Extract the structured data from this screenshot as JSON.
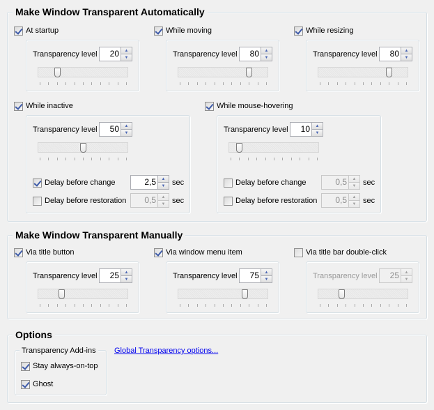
{
  "auto_group": {
    "title": "Make Window Transparent Automatically",
    "at_startup": {
      "label": "At startup",
      "checked": true,
      "level_label": "Transparency level",
      "level": "20",
      "slider_percent": 20
    },
    "while_moving": {
      "label": "While moving",
      "checked": true,
      "level_label": "Transparency level",
      "level": "80",
      "slider_percent": 80
    },
    "while_resizing": {
      "label": "While resizing",
      "checked": true,
      "level_label": "Transparency level",
      "level": "80",
      "slider_percent": 80
    },
    "while_inactive": {
      "label": "While inactive",
      "checked": true,
      "level_label": "Transparency level",
      "level": "50",
      "slider_percent": 50,
      "delay_change": {
        "label": "Delay before change",
        "checked": true,
        "value": "2,5",
        "unit": "sec"
      },
      "delay_restore": {
        "label": "Delay before restoration",
        "checked": false,
        "value": "0,5",
        "unit": "sec"
      }
    },
    "while_hovering": {
      "label": "While mouse-hovering",
      "checked": true,
      "level_label": "Transparency level",
      "level": "10",
      "slider_percent": 10,
      "delay_change": {
        "label": "Delay before change",
        "checked": false,
        "value": "0,5",
        "unit": "sec"
      },
      "delay_restore": {
        "label": "Delay before restoration",
        "checked": false,
        "value": "0,5",
        "unit": "sec"
      }
    }
  },
  "manual_group": {
    "title": "Make Window Transparent Manually",
    "via_title_button": {
      "label": "Via title button",
      "checked": true,
      "level_label": "Transparency level",
      "level": "25",
      "slider_percent": 25
    },
    "via_window_menu": {
      "label": "Via window menu item",
      "checked": true,
      "level_label": "Transparency level",
      "level": "75",
      "slider_percent": 75
    },
    "via_double_click": {
      "label": "Via title bar double-click",
      "checked": false,
      "level_label": "Transparency level",
      "level": "25",
      "slider_percent": 25
    }
  },
  "options_group": {
    "title": "Options",
    "addins": {
      "title": "Transparency Add-ins",
      "stay_on_top": {
        "label": "Stay always-on-top",
        "checked": true
      },
      "ghost": {
        "label": "Ghost",
        "checked": true
      }
    },
    "global_link": "Global Transparency options..."
  },
  "icons": {
    "spin_up": "▲",
    "spin_down": "▼"
  }
}
